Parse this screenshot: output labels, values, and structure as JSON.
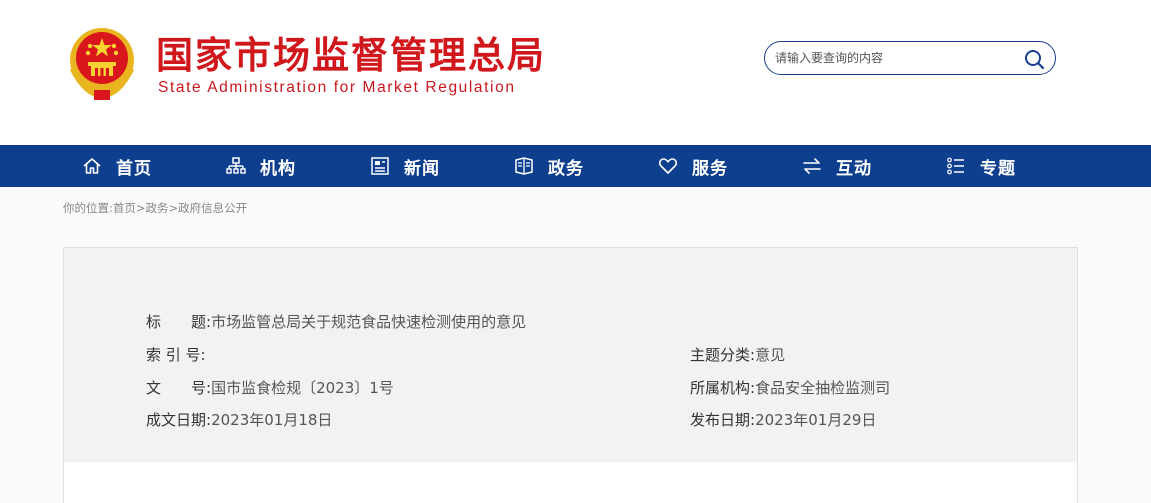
{
  "header": {
    "title": "国家市场监督管理总局",
    "subtitle": "State Administration for Market Regulation",
    "search_placeholder": "请输入要查询的内容"
  },
  "nav": {
    "items": [
      {
        "label": "首页",
        "icon": "home-icon"
      },
      {
        "label": "机构",
        "icon": "org-chart-icon"
      },
      {
        "label": "新闻",
        "icon": "news-icon"
      },
      {
        "label": "政务",
        "icon": "government-affairs-icon"
      },
      {
        "label": "服务",
        "icon": "heart-icon"
      },
      {
        "label": "互动",
        "icon": "exchange-arrows-icon"
      },
      {
        "label": "专题",
        "icon": "topics-list-icon"
      }
    ]
  },
  "breadcrumb": {
    "prefix": "你的位置:",
    "items": [
      "首页",
      "政务",
      "政府信息公开"
    ],
    "separator": ">"
  },
  "document_info": {
    "title_label": "标　　题:",
    "title_value": "市场监管总局关于规范食品快速检测使用的意见",
    "index_label": "索 引 号:",
    "index_value": "",
    "topic_label": "主题分类:",
    "topic_value": "意见",
    "doc_number_label": "文　　号:",
    "doc_number_value": "国市监食检规〔2023〕1号",
    "agency_label": "所属机构:",
    "agency_value": "食品安全抽检监测司",
    "written_date_label": "成文日期:",
    "written_date_value": "2023年01月18日",
    "publish_date_label": "发布日期:",
    "publish_date_value": "2023年01月29日"
  },
  "colors": {
    "brand_red": "#d0171c",
    "nav_blue": "#0e3f8f"
  }
}
